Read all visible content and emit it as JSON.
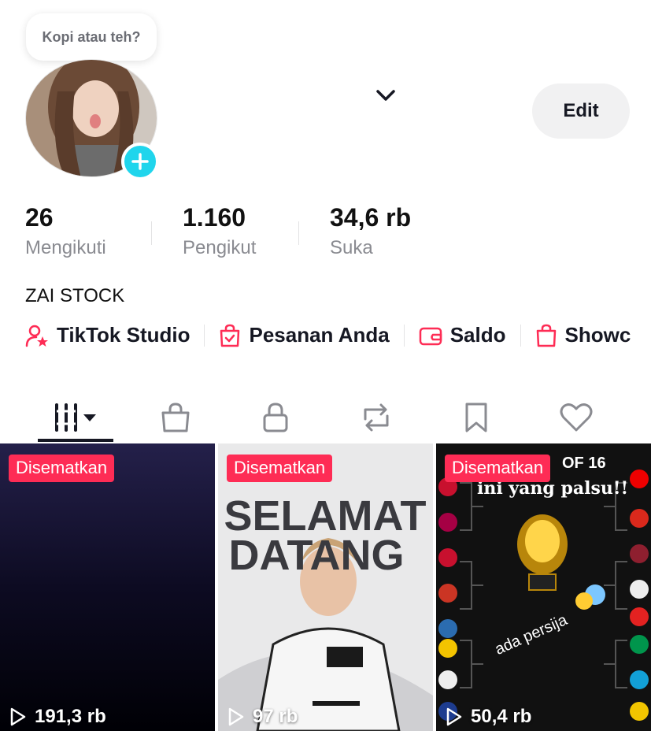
{
  "profile": {
    "note": "Kopi atau teh?",
    "name": "ZAI STOCK",
    "edit_label": "Edit"
  },
  "stats": [
    {
      "value": "26",
      "label": "Mengikuti"
    },
    {
      "value": "1.160",
      "label": "Pengikut"
    },
    {
      "value": "34,6 rb",
      "label": "Suka"
    }
  ],
  "links": [
    {
      "label": "TikTok Studio",
      "icon": "person-star-icon"
    },
    {
      "label": "Pesanan Anda",
      "icon": "shopping-bag-check-icon"
    },
    {
      "label": "Saldo",
      "icon": "wallet-icon"
    },
    {
      "label": "Showc",
      "icon": "shopping-bag-icon"
    }
  ],
  "tabs": [
    {
      "icon": "videos-grid-icon",
      "active": true
    },
    {
      "icon": "shop-bag-icon"
    },
    {
      "icon": "lock-icon"
    },
    {
      "icon": "repost-icon"
    },
    {
      "icon": "bookmark-icon"
    },
    {
      "icon": "heart-icon"
    }
  ],
  "videos": [
    {
      "pinned_label": "Disematkan",
      "views": "191,3 rb"
    },
    {
      "pinned_label": "Disematkan",
      "views": "97 rb",
      "overlay_line1": "SELAMAT",
      "overlay_line2": "DATANG"
    },
    {
      "pinned_label": "Disematkan",
      "views": "50,4 rb",
      "overlay_caption": "ini yang palsu!!",
      "sticker_text": "ada persija",
      "corner_text": "OF 16"
    }
  ],
  "colors": {
    "accent": "#fe2c55",
    "add_button": "#20d5ec",
    "text": "#161823",
    "muted": "#8a8b91"
  }
}
